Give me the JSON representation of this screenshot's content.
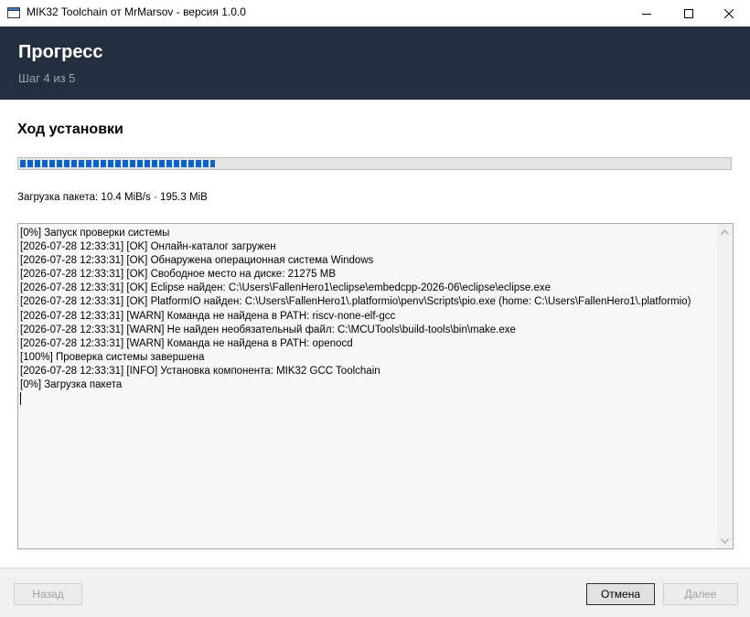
{
  "window": {
    "title": "MIK32 Toolchain от MrMarsov - версия 1.0.0",
    "icons": {
      "app": "app-icon",
      "minimize": "minimize-icon",
      "maximize": "maximize-icon",
      "close": "close-icon"
    }
  },
  "header": {
    "title": "Прогресс",
    "subtitle": "Шаг 4 из 5"
  },
  "main": {
    "section_title": "Ход установки",
    "progress_percent": 27.5,
    "accent_color": "#0a64c8",
    "status_text": "Загрузка пакета: 10.4 MiB/s · 195.3 MiB"
  },
  "log": {
    "lines": [
      "[0%] Запуск проверки системы",
      "[2026-07-28 12:33:31] [OK] Онлайн-каталог загружен",
      "[2026-07-28 12:33:31] [OK] Обнаружена операционная система Windows",
      "[2026-07-28 12:33:31] [OK] Свободное место на диске: 21275 MB",
      "[2026-07-28 12:33:31] [OK] Eclipse найден: C:\\Users\\FallenHero1\\eclipse\\embedcpp-2026-06\\eclipse\\eclipse.exe",
      "[2026-07-28 12:33:31] [OK] PlatformIO найден: C:\\Users\\FallenHero1\\.platformio\\penv\\Scripts\\pio.exe (home: C:\\Users\\FallenHero1\\.platformio)",
      "[2026-07-28 12:33:31] [WARN] Команда не найдена в PATH: riscv-none-elf-gcc",
      "[2026-07-28 12:33:31] [WARN] Не найден необязательный файл: C:\\MCUTools\\build-tools\\bin\\make.exe",
      "[2026-07-28 12:33:31] [WARN] Команда не найдена в PATH: openocd",
      "[100%] Проверка системы завершена",
      "[2026-07-28 12:33:31] [INFO] Установка компонента: MIK32 GCC Toolchain",
      "[0%] Загрузка пакета"
    ]
  },
  "footer": {
    "back_label": "Назад",
    "cancel_label": "Отмена",
    "next_label": "Далее"
  }
}
